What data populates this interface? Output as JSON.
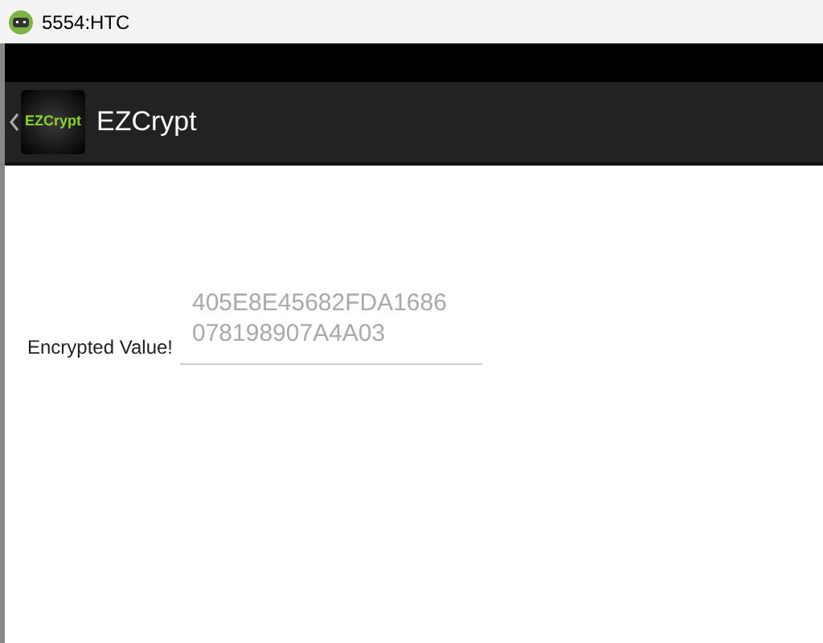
{
  "window": {
    "title": "5554:HTC"
  },
  "action_bar": {
    "logo_text": "EZCrypt",
    "title": "EZCrypt"
  },
  "form": {
    "label": "Encrypted Value!",
    "field": {
      "placeholder": "405E8E45682FDA1686 078198907A4A03"
    }
  }
}
